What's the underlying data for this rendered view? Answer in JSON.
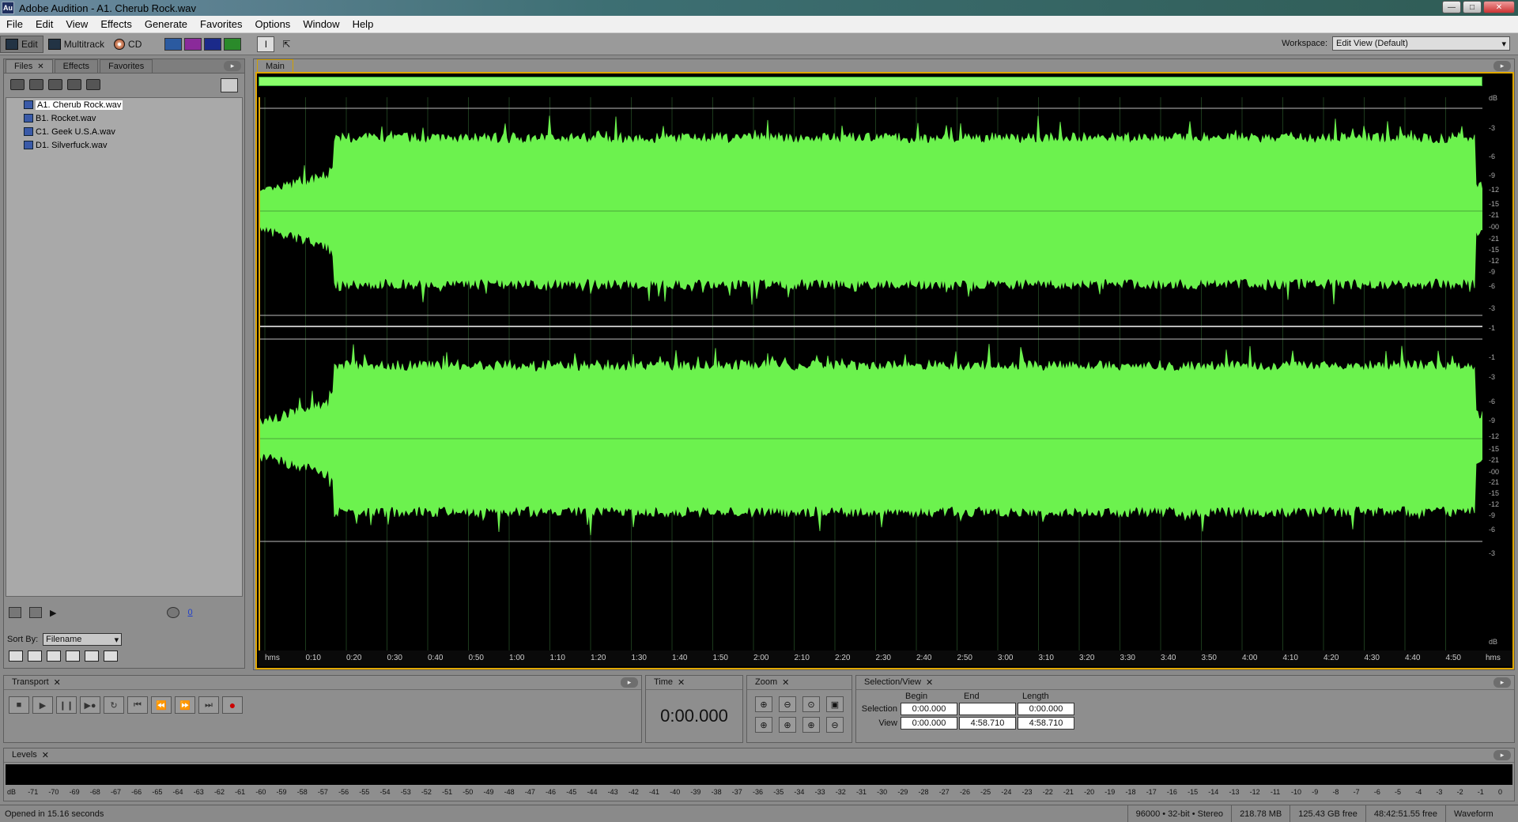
{
  "window": {
    "title": "Adobe Audition - A1. Cherub Rock.wav",
    "app_icon": "Au"
  },
  "menu": [
    "File",
    "Edit",
    "View",
    "Effects",
    "Generate",
    "Favorites",
    "Options",
    "Window",
    "Help"
  ],
  "toolbar": {
    "edit_label": "Edit",
    "multitrack_label": "Multitrack",
    "cd_label": "CD",
    "workspace_label": "Workspace:",
    "workspace_value": "Edit View (Default)"
  },
  "files_panel": {
    "tabs": [
      "Files",
      "Effects",
      "Favorites"
    ],
    "files": [
      "A1. Cherub Rock.wav",
      "B1. Rocket.wav",
      "C1. Geek U.S.A.wav",
      "D1. Silverfuck.wav"
    ],
    "volume_value": "0",
    "sort_label": "Sort By:",
    "sort_value": "Filename"
  },
  "main_panel": {
    "tab": "Main",
    "db_unit": "dB",
    "db_labels": [
      "-3",
      "-6",
      "-9",
      "-12",
      "-15",
      "-21",
      "-00",
      "-21",
      "-15",
      "-12",
      "-9",
      "-6",
      "-3",
      "-1",
      "-1",
      "-3",
      "-6",
      "-9",
      "-12",
      "-15",
      "-21",
      "-00",
      "-21",
      "-15",
      "-12",
      "-9",
      "-6",
      "-3"
    ],
    "time_labels": [
      "hms",
      "0:10",
      "0:20",
      "0:30",
      "0:40",
      "0:50",
      "1:00",
      "1:10",
      "1:20",
      "1:30",
      "1:40",
      "1:50",
      "2:00",
      "2:10",
      "2:20",
      "2:30",
      "2:40",
      "2:50",
      "3:00",
      "3:10",
      "3:20",
      "3:30",
      "3:40",
      "3:50",
      "4:00",
      "4:10",
      "4:20",
      "4:30",
      "4:40",
      "4:50",
      "hms"
    ],
    "wave_color": "#6cf24e"
  },
  "transport": {
    "title": "Transport"
  },
  "time_panel": {
    "title": "Time",
    "value": "0:00.000"
  },
  "zoom_panel": {
    "title": "Zoom"
  },
  "selection_panel": {
    "title": "Selection/View",
    "headers": [
      "Begin",
      "End",
      "Length"
    ],
    "selection_label": "Selection",
    "view_label": "View",
    "selection": [
      "0:00.000",
      "",
      "0:00.000"
    ],
    "view": [
      "0:00.000",
      "4:58.710",
      "4:58.710"
    ]
  },
  "levels": {
    "title": "Levels",
    "scale": [
      "dB",
      "-71",
      "-70",
      "-69",
      "-68",
      "-67",
      "-66",
      "-65",
      "-64",
      "-63",
      "-62",
      "-61",
      "-60",
      "-59",
      "-58",
      "-57",
      "-56",
      "-55",
      "-54",
      "-53",
      "-52",
      "-51",
      "-50",
      "-49",
      "-48",
      "-47",
      "-46",
      "-45",
      "-44",
      "-43",
      "-42",
      "-41",
      "-40",
      "-39",
      "-38",
      "-37",
      "-36",
      "-35",
      "-34",
      "-33",
      "-32",
      "-31",
      "-30",
      "-29",
      "-28",
      "-27",
      "-26",
      "-25",
      "-24",
      "-23",
      "-22",
      "-21",
      "-20",
      "-19",
      "-18",
      "-17",
      "-16",
      "-15",
      "-14",
      "-13",
      "-12",
      "-11",
      "-10",
      "-9",
      "-8",
      "-7",
      "-6",
      "-5",
      "-4",
      "-3",
      "-2",
      "-1",
      "0"
    ]
  },
  "status": {
    "message": "Opened in 15.16 seconds",
    "format": "96000 • 32-bit • Stereo",
    "file_size": "218.78 MB",
    "disk_free": "125.43 GB free",
    "time_free": "48:42:51.55 free",
    "view_mode": "Waveform"
  }
}
